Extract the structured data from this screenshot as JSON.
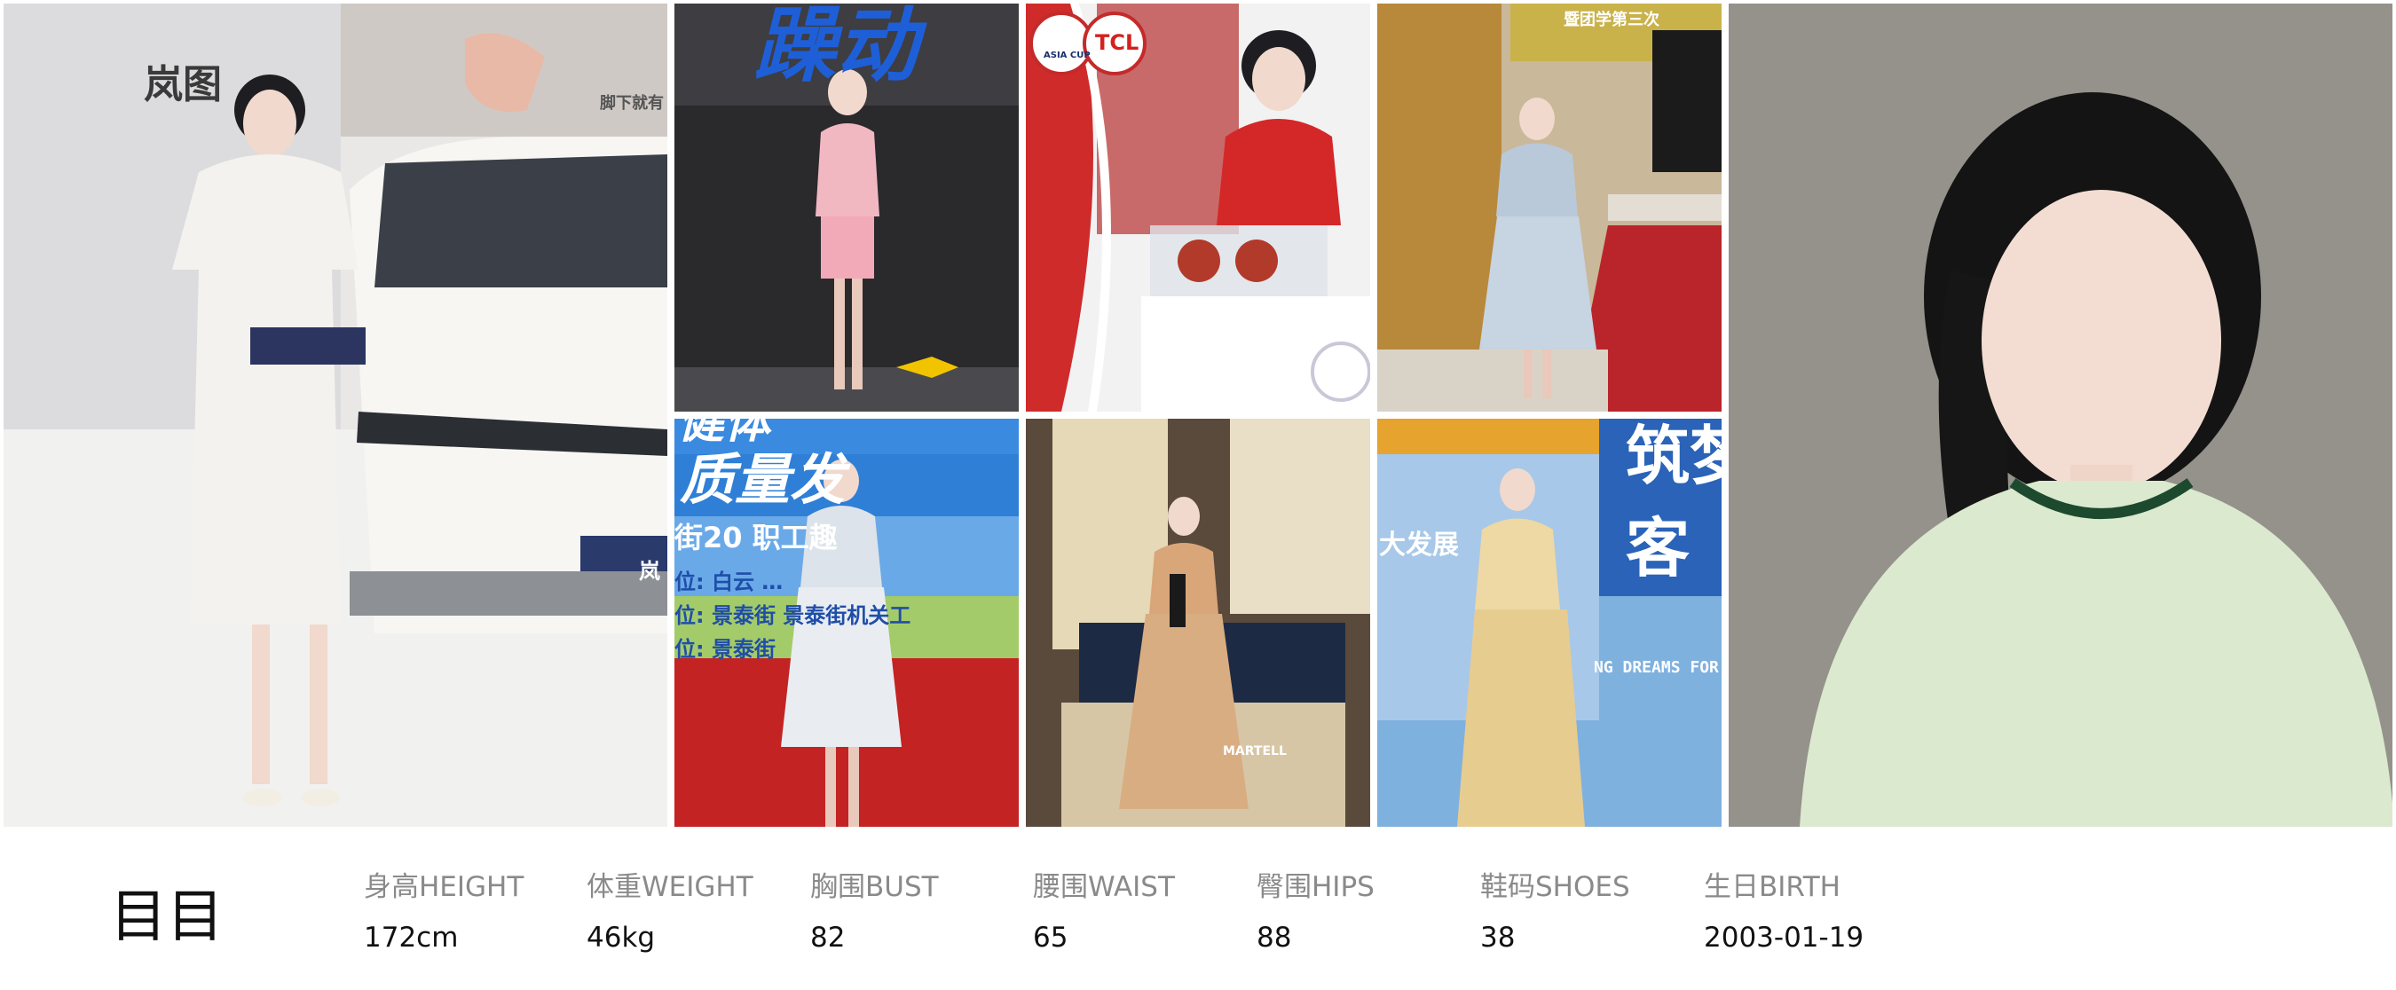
{
  "photos": {
    "p1": {
      "brand_text": "岚图",
      "board_text": "脚下就有",
      "plate_text": "岚"
    },
    "p2": {
      "banner_text": "躁动"
    },
    "p3": {
      "logo_text": "TCL",
      "badge_text": "ASIA CUP"
    },
    "p4": {
      "screen_text": "暨团学第三次"
    },
    "p5": {
      "line1": "健体",
      "line2": "质量发",
      "line3": "街20  职工趣",
      "line4": "位: 白云 …",
      "line5": "位: 景泰街  景泰街机关工",
      "line6": "位: 景泰街"
    },
    "p6": {
      "sign_text": "MARTELL"
    },
    "p7": {
      "line1": "筑梦",
      "line2": "客",
      "line3": "大发展",
      "line4": "NG DREAMS FOR T"
    }
  },
  "profile": {
    "name": "目目",
    "stats": [
      {
        "label": "身高HEIGHT",
        "value": "172cm"
      },
      {
        "label": "体重WEIGHT",
        "value": "46kg"
      },
      {
        "label": "胸围BUST",
        "value": "82"
      },
      {
        "label": "腰围WAIST",
        "value": "65"
      },
      {
        "label": "臀围HIPS",
        "value": "88"
      },
      {
        "label": "鞋码SHOES",
        "value": "38"
      },
      {
        "label": "生日BIRTH",
        "value": "2003-01-19"
      }
    ]
  }
}
